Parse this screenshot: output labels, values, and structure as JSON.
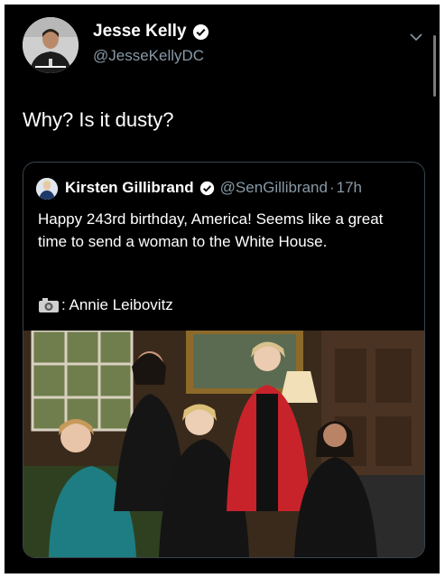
{
  "author": {
    "name": "Jesse Kelly",
    "handle": "@JesseKellyDC"
  },
  "tweet": {
    "text": "Why? Is it dusty?"
  },
  "quoted": {
    "name": "Kirsten Gillibrand",
    "handle": "@SenGillibrand",
    "separator": "·",
    "time": "17h",
    "text": "Happy 243rd birthday, America! Seems like a great time to send a woman to the White House.",
    "credit_icon": "camera-icon",
    "credit": ": Annie Leibovitz"
  },
  "icons": {
    "verified": "verified-badge-icon",
    "menu": "chevron-down-icon"
  },
  "colors": {
    "background": "#000000",
    "text": "#ffffff",
    "secondary": "#8899a6",
    "border": "#38444d"
  }
}
